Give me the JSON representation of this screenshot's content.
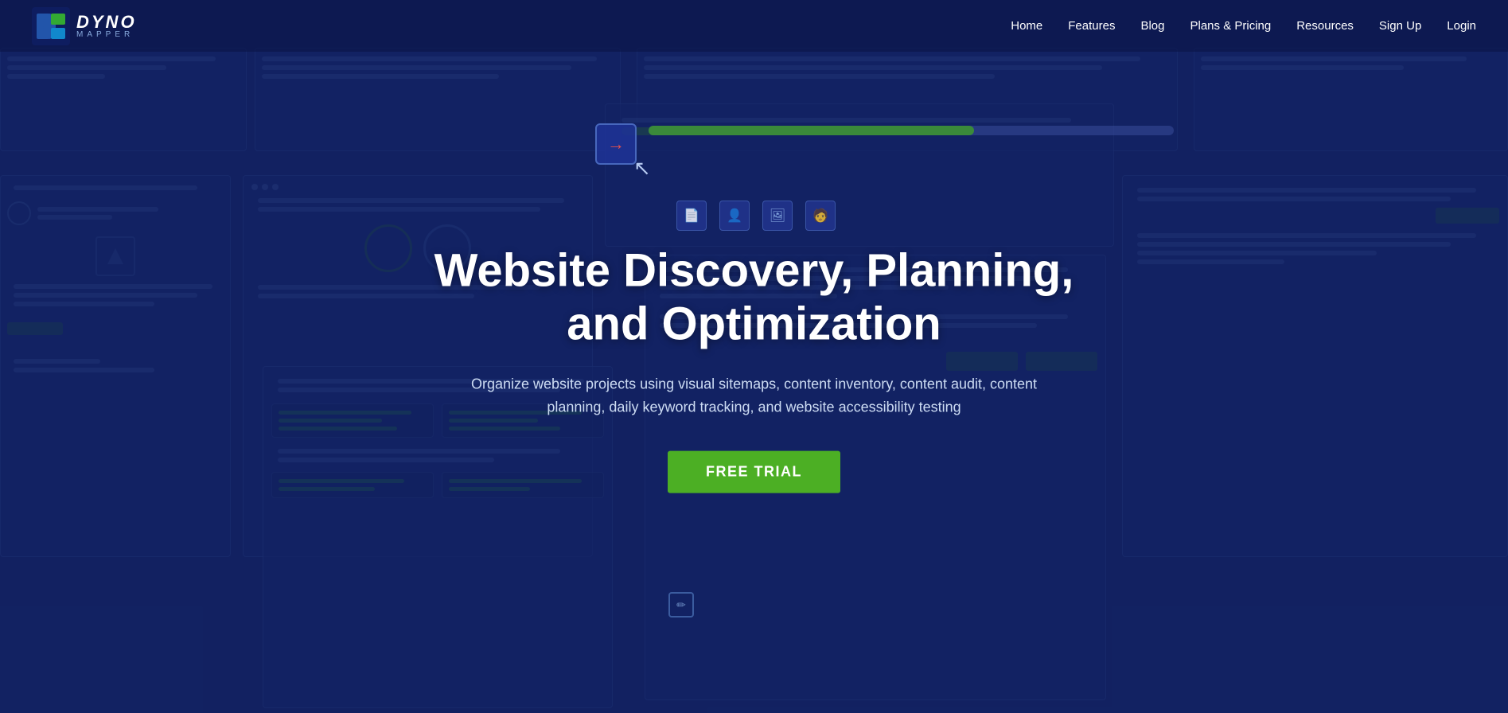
{
  "nav": {
    "logo_alt": "Dyno Mapper Logo",
    "logo_dyno": "DYNO",
    "logo_mapper": "MAPPER",
    "links": [
      {
        "label": "Home",
        "href": "#"
      },
      {
        "label": "Features",
        "href": "#"
      },
      {
        "label": "Blog",
        "href": "#"
      },
      {
        "label": "Plans & Pricing",
        "href": "#"
      },
      {
        "label": "Resources",
        "href": "#"
      },
      {
        "label": "Sign Up",
        "href": "#"
      },
      {
        "label": "Login",
        "href": "#"
      }
    ]
  },
  "hero": {
    "title": "Website Discovery, Planning, and Optimization",
    "subtitle": "Organize website projects using visual sitemaps, content inventory, content audit, content planning, daily keyword tracking, and website accessibility testing",
    "cta_label": "FREE TRIAL"
  }
}
